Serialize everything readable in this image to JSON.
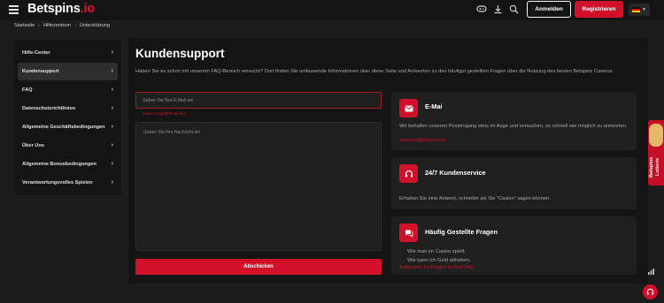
{
  "header": {
    "logo_main": "Betspins",
    "logo_accent": ".io",
    "login_label": "Anmelden",
    "register_label": "Registrieren",
    "icons": [
      "gamepad-icon",
      "download-icon",
      "search-icon"
    ],
    "language": "de"
  },
  "breadcrumb": [
    "Startseite",
    "Hilfezentrum",
    "Unterstützung"
  ],
  "sidebar": {
    "items": [
      {
        "label": "Hilfe-Center",
        "active": false
      },
      {
        "label": "Kundensupport",
        "active": true
      },
      {
        "label": "FAQ",
        "active": false
      },
      {
        "label": "Datenschutzrichtlinien",
        "active": false
      },
      {
        "label": "Allgemeine Geschäftsbedingungen",
        "active": false
      },
      {
        "label": "Über Uns",
        "active": false
      },
      {
        "label": "Allgemeine Bonusbedingungen",
        "active": false
      },
      {
        "label": "Verantwortungsvolles Spielen",
        "active": false
      }
    ]
  },
  "main": {
    "title": "Kundensupport",
    "intro": "Haben Sie es schon mit unserem FAQ-Bereich versucht? Dort finden Sie umfassende Informationen über diese Seite und Antworten zu den häufigst gestellten Fragen über die Nutzung des besten Betspins Casinos.",
    "form": {
      "email_placeholder": "Geben Sie Ihre E-Mail ein",
      "email_error": "Muss Ausgefühlt werden",
      "message_placeholder": "Geben Sie Ihre Nachricht ein",
      "submit_label": "Abschicken"
    },
    "cards": {
      "email": {
        "title": "E-Mai",
        "text": "Wir behalten unseren Posteingang stets im Auge und versuchen, so schnell wie möglich zu antworten.",
        "link": "support@betspins.io"
      },
      "service": {
        "title": "24/7 Kundenservice",
        "text": "Erhalten Sie eine Antwort, schneller als Sie \"Casino\" sagen können."
      },
      "faq": {
        "title": "Häufig Gestellte Fragen",
        "items": [
          "Wie man im Casino spielt;",
          "Wie kann ich Geld abheben;"
        ],
        "link": "Antworten Zu Fragen In Dnd FAQ"
      }
    }
  },
  "lotterie": "Betspins Lotterie",
  "colors": {
    "accent": "#d3102a",
    "bg": "#1c1c1c",
    "panel": "#141414",
    "card": "#1f1f1f"
  }
}
